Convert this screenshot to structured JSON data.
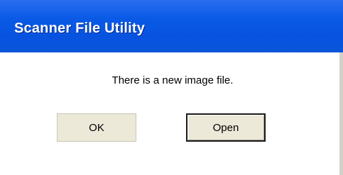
{
  "window": {
    "title": "Scanner File Utility"
  },
  "dialog": {
    "message": "There is a new image file."
  },
  "buttons": {
    "ok_label": "OK",
    "open_label": "Open"
  },
  "colors": {
    "titlebar": "#0753e0",
    "dialog_background": "#ffffff",
    "button_face": "#ece9d8"
  }
}
